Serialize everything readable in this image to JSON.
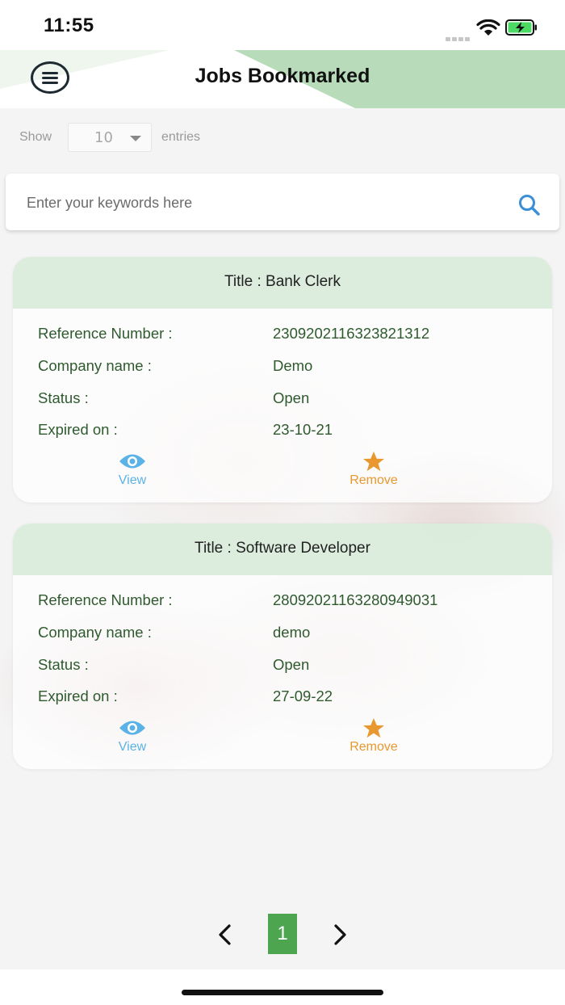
{
  "status_bar": {
    "time": "11:55"
  },
  "header": {
    "title": "Jobs Bookmarked",
    "accent": "#b8dcb9"
  },
  "entries": {
    "show_label": "Show",
    "selected": "10",
    "suffix_label": "entries"
  },
  "search": {
    "placeholder": "Enter your keywords here"
  },
  "labels": {
    "reference": "Reference Number :",
    "company": "Company name :",
    "status": "Status :",
    "expired": "Expired on :",
    "view": "View",
    "remove": "Remove"
  },
  "jobs": [
    {
      "title": "Title : Bank Clerk",
      "reference": "2309202116323821312",
      "company": "Demo",
      "status": "Open",
      "expired": "23-10-21"
    },
    {
      "title": "Title : Software Developer",
      "reference": "2809202116328094903​1",
      "company": "demo",
      "status": "Open",
      "expired": "27-09-22"
    }
  ],
  "pagination": {
    "current": "1"
  },
  "colors": {
    "pager_active": "#4ea550",
    "view": "#5bb2e6",
    "remove": "#e8982f",
    "text_green": "#2e5a2e"
  }
}
